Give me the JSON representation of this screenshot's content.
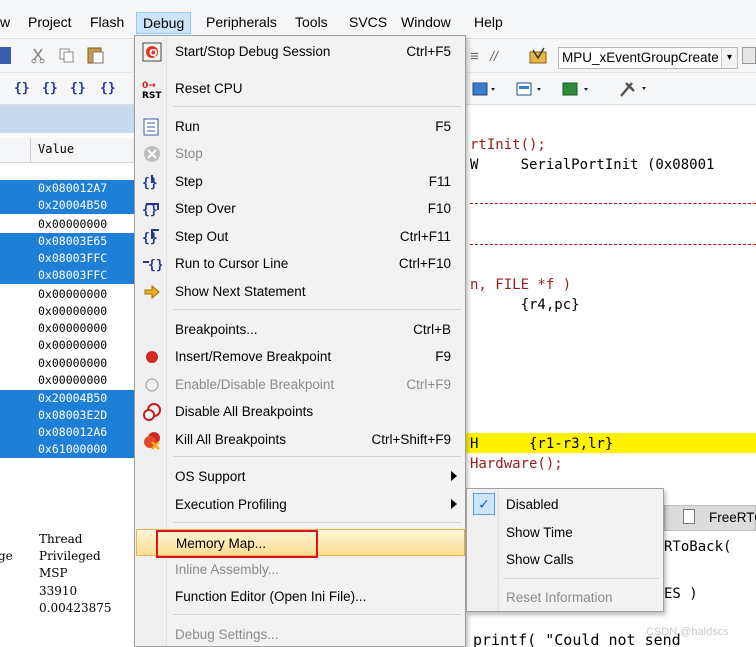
{
  "menubar": {
    "items": [
      "w",
      "Project",
      "Flash",
      "Debug",
      "Peripherals",
      "Tools",
      "SVCS",
      "Window",
      "Help"
    ],
    "active": "Debug"
  },
  "toolbar": {
    "target_name": "MPU_xEventGroupCreate",
    "step_glyphs": [
      "{}",
      "{}",
      "{}",
      "{}"
    ]
  },
  "registers": {
    "value_header": "Value",
    "values": [
      "0x080012A7",
      "0x20004B50",
      "0x00000000",
      "0x08003E65",
      "0x08003FFC",
      "0x08003FFC",
      "0x00000000",
      "0x00000000",
      "0x00000000",
      "0x00000000",
      "0x00000000",
      "0x00000000",
      "0x20004B50",
      "0x08003E2D",
      "0x080012A6",
      "0x61000000"
    ],
    "status_left": [
      "ge"
    ],
    "status_values": [
      "Thread",
      "Privileged",
      "MSP",
      "33910",
      "0.00423875"
    ]
  },
  "code": {
    "lines": [
      "rtInit();",
      "W     SerialPortInit (0x08001",
      "n, FILE *f )",
      "      {r4,pc}",
      "H      {r1-r3,lr}",
      "Hardware();",
      "RToBack(",
      "ES )",
      "printf( \"Could not send"
    ]
  },
  "tab": {
    "label": "FreeRTO"
  },
  "debug_menu": {
    "items": [
      {
        "label": "Start/Stop Debug Session",
        "shortcut": "Ctrl+F5",
        "icon": "debug-session-icon"
      },
      {
        "label": "Reset CPU",
        "shortcut": "",
        "icon": "reset-cpu-icon"
      },
      {
        "label": "Run",
        "shortcut": "F5",
        "icon": "run-icon"
      },
      {
        "label": "Stop",
        "shortcut": "",
        "icon": "stop-icon"
      },
      {
        "label": "Step",
        "shortcut": "F11",
        "icon": "step-icon"
      },
      {
        "label": "Step Over",
        "shortcut": "F10",
        "icon": "step-over-icon"
      },
      {
        "label": "Step Out",
        "shortcut": "Ctrl+F11",
        "icon": "step-out-icon"
      },
      {
        "label": "Run to Cursor Line",
        "shortcut": "Ctrl+F10",
        "icon": "run-to-cursor-icon"
      },
      {
        "label": "Show Next Statement",
        "shortcut": "",
        "icon": "next-statement-arrow-icon"
      },
      {
        "label": "Breakpoints...",
        "shortcut": "Ctrl+B",
        "icon": ""
      },
      {
        "label": "Insert/Remove Breakpoint",
        "shortcut": "F9",
        "icon": "breakpoint-dot-icon"
      },
      {
        "label": "Enable/Disable Breakpoint",
        "shortcut": "Ctrl+F9",
        "icon": "breakpoint-hollow-icon"
      },
      {
        "label": "Disable All Breakpoints",
        "shortcut": "",
        "icon": "disable-breakpoints-icon"
      },
      {
        "label": "Kill All Breakpoints",
        "shortcut": "Ctrl+Shift+F9",
        "icon": "kill-breakpoints-icon"
      },
      {
        "label": "OS Support",
        "shortcut": "",
        "icon": ""
      },
      {
        "label": "Execution Profiling",
        "shortcut": "",
        "icon": ""
      },
      {
        "label": "Memory Map...",
        "shortcut": "",
        "icon": ""
      },
      {
        "label": "Inline Assembly...",
        "shortcut": "",
        "icon": ""
      },
      {
        "label": "Function Editor (Open Ini File)...",
        "shortcut": "",
        "icon": ""
      },
      {
        "label": "Debug Settings...",
        "shortcut": "",
        "icon": ""
      }
    ]
  },
  "submenu": {
    "items": [
      {
        "label": "Disabled",
        "checked": true
      },
      {
        "label": "Show Time"
      },
      {
        "label": "Show Calls"
      },
      {
        "label": "Reset Information"
      }
    ]
  },
  "watermark": "CSDN @haldscs",
  "colors": {
    "selection": "#1e7fd6",
    "menu_hover": "#fbdd92",
    "highlight_line": "#fff200",
    "annotation_box": "#d9151b"
  }
}
